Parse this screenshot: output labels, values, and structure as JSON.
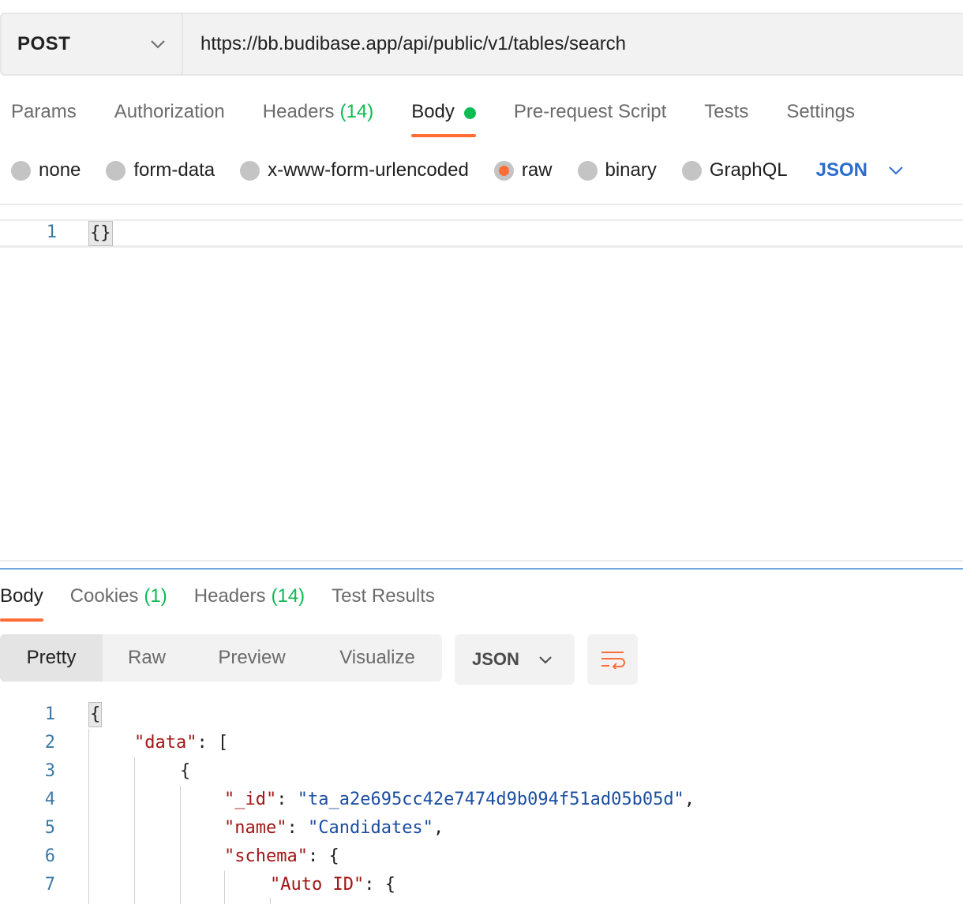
{
  "request": {
    "method": "POST",
    "url": "https://bb.budibase.app/api/public/v1/tables/search",
    "tabs": [
      {
        "label": "Params"
      },
      {
        "label": "Authorization"
      },
      {
        "label": "Headers",
        "count": "(14)"
      },
      {
        "label": "Body"
      },
      {
        "label": "Pre-request Script"
      },
      {
        "label": "Tests"
      },
      {
        "label": "Settings"
      }
    ],
    "active_tab": "Body",
    "body_types": [
      "none",
      "form-data",
      "x-www-form-urlencoded",
      "raw",
      "binary",
      "GraphQL"
    ],
    "selected_body_type": "raw",
    "body_format": "JSON",
    "editor": {
      "line_numbers": [
        "1"
      ],
      "lines": [
        "{}"
      ]
    }
  },
  "response": {
    "tabs": [
      {
        "label": "Body"
      },
      {
        "label": "Cookies",
        "count": "(1)"
      },
      {
        "label": "Headers",
        "count": "(14)"
      },
      {
        "label": "Test Results"
      }
    ],
    "active_tab": "Body",
    "views": [
      "Pretty",
      "Raw",
      "Preview",
      "Visualize"
    ],
    "active_view": "Pretty",
    "format": "JSON",
    "line_numbers": [
      "1",
      "2",
      "3",
      "4",
      "5",
      "6",
      "7"
    ],
    "code": {
      "l1": "{",
      "l2_key": "\"data\"",
      "l2_rest": ": [",
      "l3": "{",
      "l4_key": "\"_id\"",
      "l4_sep": ": ",
      "l4_val": "\"ta_a2e695cc42e7474d9b094f51ad05b05d\"",
      "l4_end": ",",
      "l5_key": "\"name\"",
      "l5_sep": ": ",
      "l5_val": "\"Candidates\"",
      "l5_end": ",",
      "l6_key": "\"schema\"",
      "l6_rest": ": {",
      "l7_key": "\"Auto ID\"",
      "l7_rest": ": {"
    }
  },
  "colors": {
    "accent": "#ff6c37",
    "active_dot": "#0cbb52",
    "link_blue": "#2c6ccc",
    "json_key": "#a31515",
    "json_string": "#1c4ea1"
  }
}
